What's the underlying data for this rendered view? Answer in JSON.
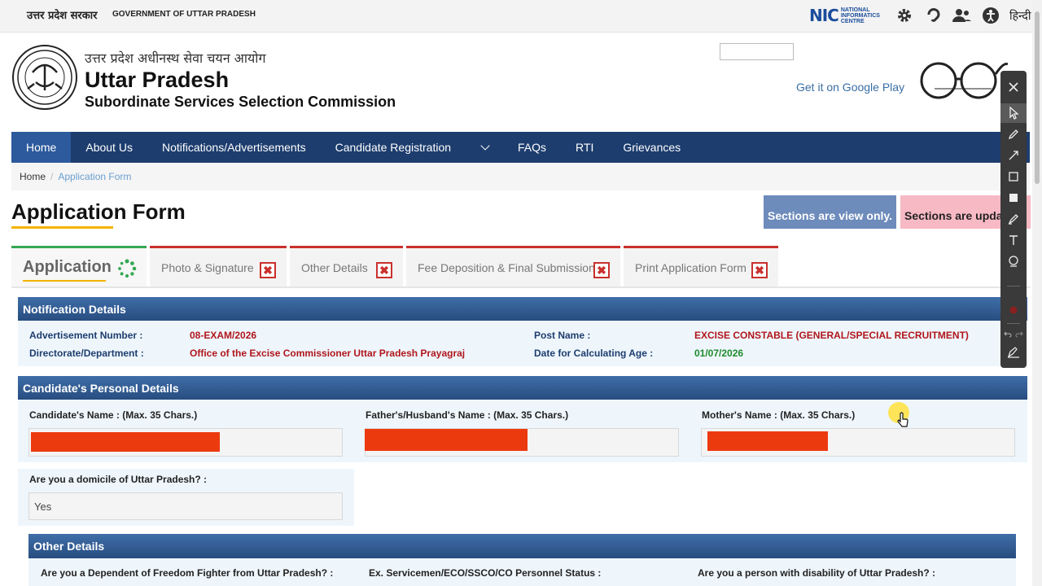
{
  "topbar": {
    "gov_hindi": "उत्तर प्रदेश सरकार",
    "gov_english": "GOVERNMENT OF UTTAR PRADESH",
    "nic_mark": "NIC",
    "nic_text": "NATIONAL INFORMATICS CENTRE",
    "icons": [
      "gear-icon",
      "hearing-icon",
      "users-icon",
      "accessibility-icon"
    ],
    "language": "हिन्दी"
  },
  "header": {
    "org_hindi": "उत्तर प्रदेश अधीनस्थ सेवा चयन आयोग",
    "org_title": "Uttar Pradesh",
    "org_subtitle": "Subordinate Services Selection Commission",
    "google_play_alt": "Get it on Google Play"
  },
  "nav": {
    "items": [
      "Home",
      "About Us",
      "Notifications/Advertisements",
      "Candidate Registration",
      "FAQs",
      "RTI",
      "Grievances"
    ],
    "active": "Home"
  },
  "breadcrumb": {
    "home": "Home",
    "sep": "/",
    "current": "Application Form"
  },
  "page": {
    "title": "Application Form",
    "notice_view_only": "Sections are view only.",
    "notice_update": "Sections are upda"
  },
  "tabs": [
    {
      "label": "Application",
      "status": "in-progress"
    },
    {
      "label": "Photo & Signature",
      "status": "incomplete"
    },
    {
      "label": "Other Details",
      "status": "incomplete"
    },
    {
      "label": "Fee Deposition & Final Submission",
      "status": "incomplete"
    },
    {
      "label": "Print Application Form",
      "status": "incomplete"
    }
  ],
  "notification": {
    "heading": "Notification Details",
    "adv_label": "Advertisement Number :",
    "adv_value": "08-EXAM/2026",
    "dept_label": "Directorate/Department :",
    "dept_value": "Office of the Excise Commissioner Uttar Pradesh Prayagraj",
    "post_label": "Post Name :",
    "post_value": "EXCISE CONSTABLE (GENERAL/SPECIAL RECRUITMENT)",
    "age_label": "Date for Calculating Age :",
    "age_value": "01/07/2026"
  },
  "personal": {
    "heading": "Candidate's Personal Details",
    "name_label": "Candidate's Name : (Max. 35 Chars.)",
    "father_label": "Father's/Husband's Name : (Max. 35 Chars.)",
    "mother_label": "Mother's Name : (Max. 35 Chars.)",
    "domicile_label": "Are you a domicile of Uttar Pradesh? :",
    "domicile_value": "Yes"
  },
  "other": {
    "heading": "Other Details",
    "freedom_label": "Are you a Dependent of Freedom Fighter from Uttar Pradesh? :",
    "exservice_label": "Ex. Servicemen/ECO/SSCO/CO Personnel Status :",
    "disability_label": "Are you a person with disability of Uttar Pradesh? :"
  },
  "colors": {
    "nav_bg": "#1d3d6e",
    "section_header": "#2f5b92",
    "value_red": "#b0161b",
    "value_green": "#1f8a2c",
    "redaction": "#ec3a0f",
    "accent_yellow": "#f4b400"
  },
  "annotation_toolbar": {
    "tools": [
      "close-icon",
      "pointer-icon",
      "pen-icon",
      "arrow-icon",
      "rectangle-icon",
      "filled-rectangle-icon",
      "highlighter-icon",
      "text-icon",
      "stamp-icon",
      "color-icon",
      "undo-icon",
      "redo-icon",
      "erase-icon"
    ]
  }
}
